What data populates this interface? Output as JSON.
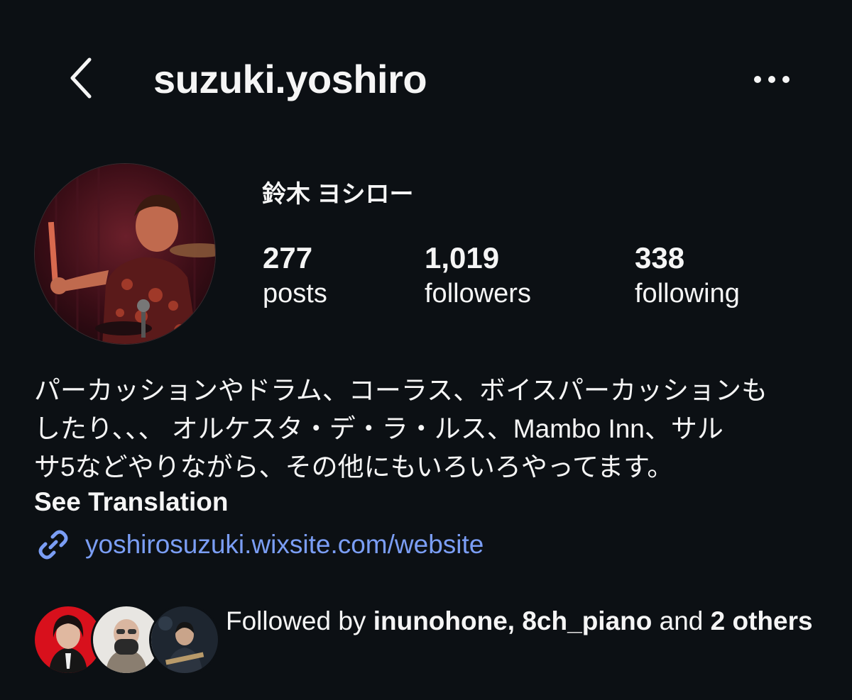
{
  "header": {
    "username": "suzuki.yoshiro",
    "back_icon": "chevron-left-icon",
    "more_icon": "more-horizontal-icon"
  },
  "profile": {
    "display_name": "鈴木 ヨシロー",
    "avatar": "profile-photo-drummer"
  },
  "stats": {
    "posts": {
      "value": "277",
      "label": "posts"
    },
    "followers": {
      "value": "1,019",
      "label": "followers"
    },
    "following": {
      "value": "338",
      "label": "following"
    }
  },
  "bio": {
    "text": "パーカッションやドラム、コーラス、ボイスパーカッションも\nしたり、、、 オルケスタ・デ・ラ・ルス、Mambo Inn、サル\nサ5などやりながら、その他にもいろいろやってます。",
    "see_translation": "See Translation",
    "website": "yoshirosuzuki.wixsite.com/website",
    "link_icon": "link-icon"
  },
  "followed_by": {
    "prefix": "Followed by ",
    "user1": "inunohone",
    "separator": ", ",
    "user2": "8ch_piano",
    "middle": " and ",
    "others": "2 others"
  },
  "colors": {
    "background": "#0c1014",
    "text": "#f5f5f5",
    "link": "#7b9ef5"
  }
}
